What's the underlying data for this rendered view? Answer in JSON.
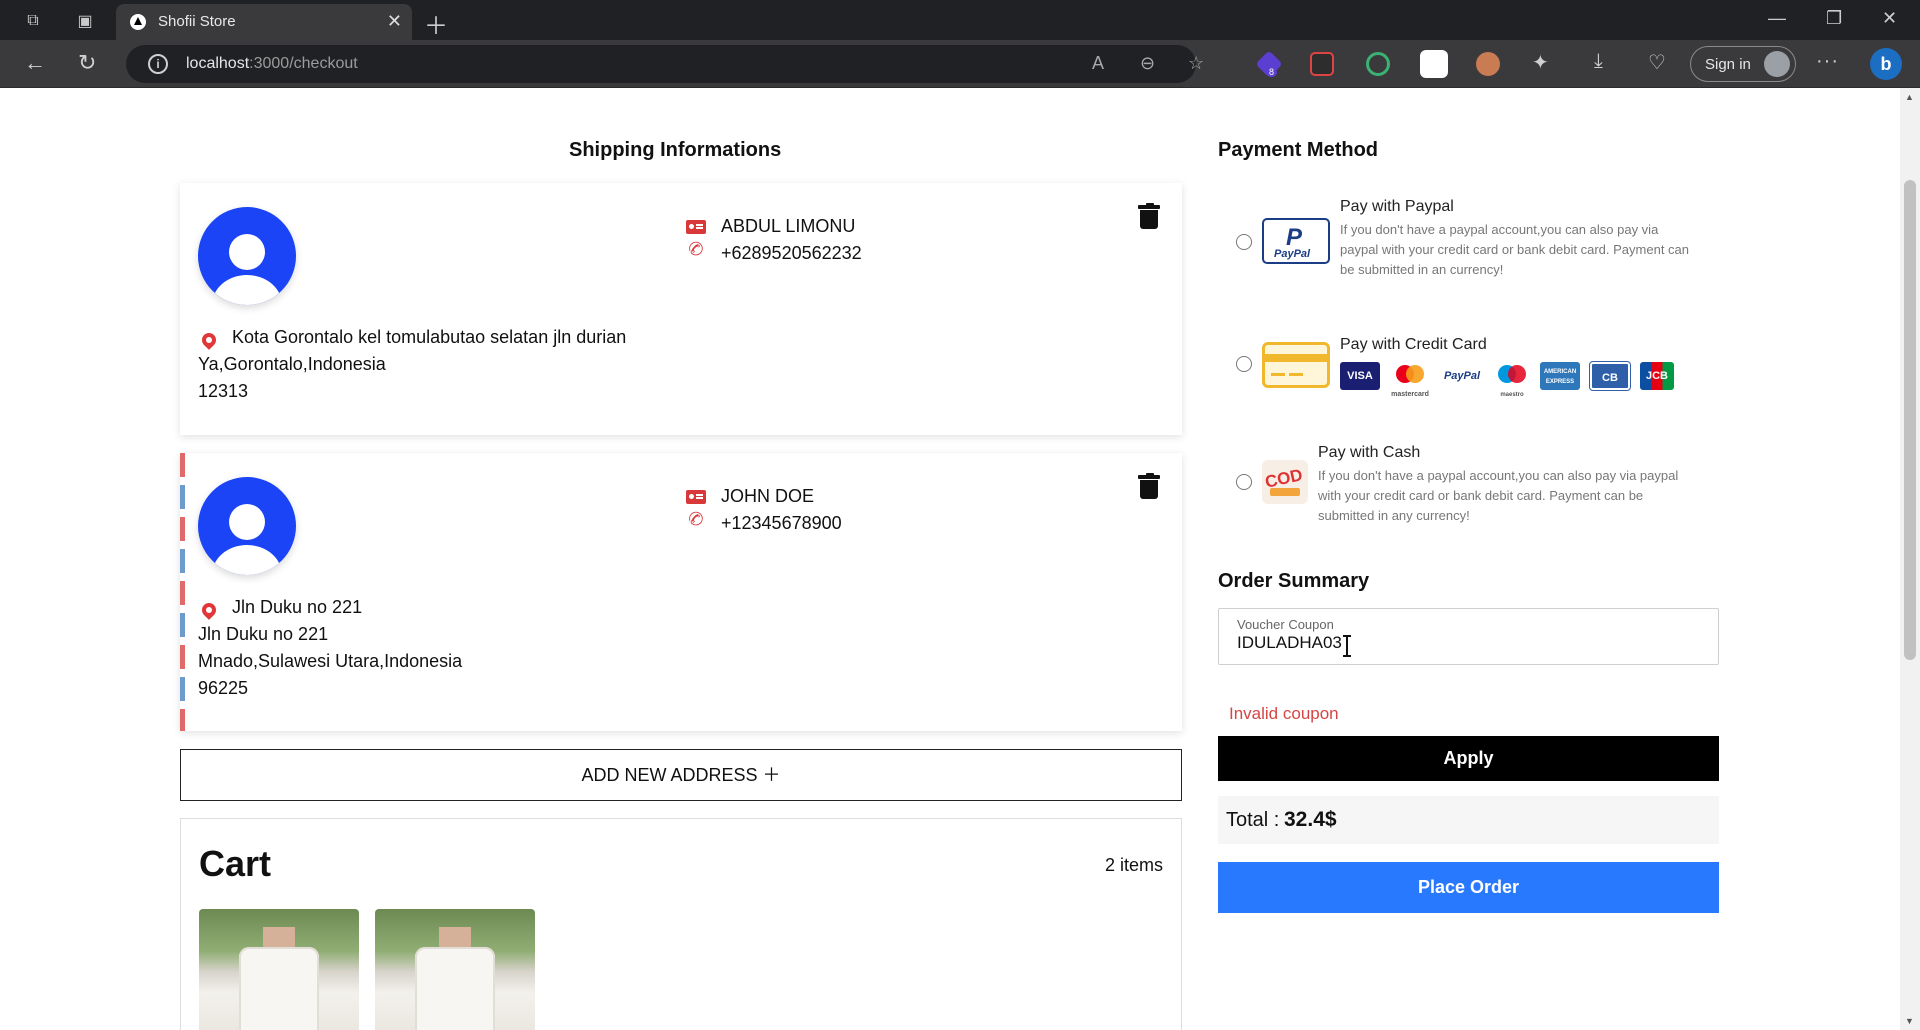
{
  "browser": {
    "tab_title": "Shofii Store",
    "url_host": "localhost",
    "url_path": ":3000/checkout",
    "signin_label": "Sign in",
    "extension_badge": "8"
  },
  "shipping": {
    "title": "Shipping Informations",
    "addresses": [
      {
        "name": "ABDUL LIMONU",
        "phone": "+6289520562232",
        "address_line1": "Kota Gorontalo kel tomulabutao selatan jln durian",
        "address_line2": "Ya,Gorontalo,Indonesia",
        "postal": "12313"
      },
      {
        "name": "JOHN DOE",
        "phone": "+12345678900",
        "address_line1": "Jln Duku no 221",
        "address_line2": "Jln Duku no 221",
        "address_line3": "Mnado,Sulawesi Utara,Indonesia",
        "postal": "96225"
      }
    ],
    "add_address_label": "ADD NEW ADDRESS ＋"
  },
  "cart": {
    "title": "Cart",
    "count": "2 items"
  },
  "payment": {
    "title": "Payment Method",
    "options": [
      {
        "title": "Pay with Paypal",
        "logo_text": "PayPal",
        "description": "If you don't have a paypal account,you can also pay via paypal with your credit card or bank debit card. Payment can be submitted in an currency!"
      },
      {
        "title": "Pay with Credit Card",
        "brands": [
          "VISA",
          "mastercard",
          "PayPal",
          "maestro",
          "AMERICAN EXPRESS",
          "CB",
          "JCB"
        ]
      },
      {
        "title": "Pay with Cash",
        "logo_text": "COD",
        "description": "If you don't have a paypal account,you can also pay via paypal with your credit card or bank debit card. Payment can be submitted in any currency!"
      }
    ]
  },
  "summary": {
    "title": "Order Summary",
    "coupon_label": "Voucher Coupon",
    "coupon_value": "IDULADHA03",
    "error": "Invalid coupon",
    "apply_label": "Apply",
    "total_label": "Total :",
    "total_value": "32.4$",
    "place_order_label": "Place Order"
  },
  "colors": {
    "accent_blue": "#2979ff",
    "avatar_blue": "#1a44f5",
    "icon_red": "#d8383a",
    "error_red": "#d64545"
  }
}
